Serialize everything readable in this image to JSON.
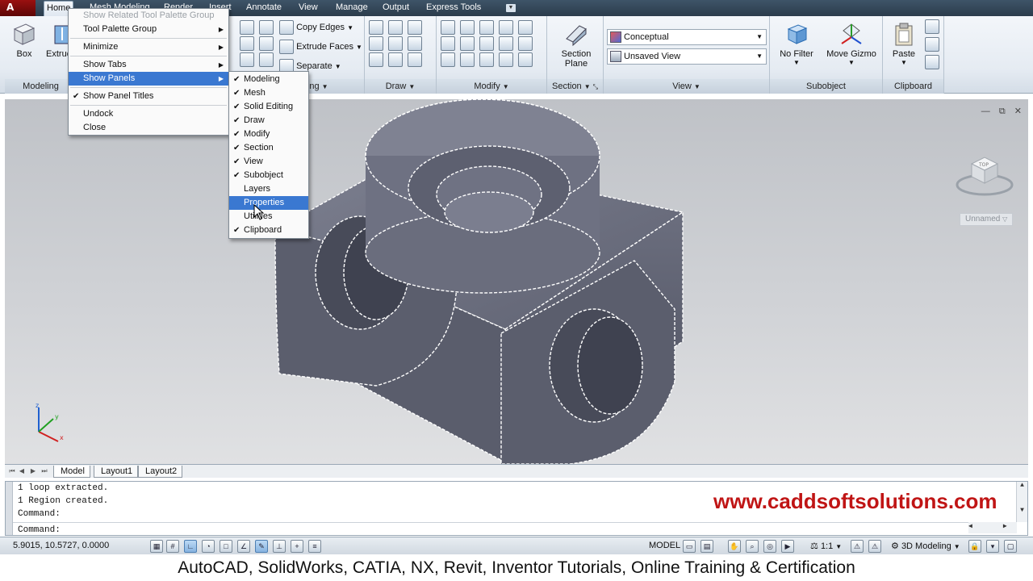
{
  "app": {
    "logo_letter": "A"
  },
  "tabs": [
    {
      "label": "Home",
      "active": true
    },
    {
      "label": "Mesh Modeling"
    },
    {
      "label": "Render"
    },
    {
      "label": "Insert"
    },
    {
      "label": "Annotate"
    },
    {
      "label": "View"
    },
    {
      "label": "Manage"
    },
    {
      "label": "Output"
    },
    {
      "label": "Express Tools"
    }
  ],
  "ribbon": {
    "modeling": {
      "box_label": "Box",
      "extrude_label": "Extrude",
      "title": "Modeling"
    },
    "solid_editing": {
      "copy_edges": "Copy Edges",
      "extrude_faces": "Extrude Faces",
      "separate": "Separate",
      "title": "Solid Editing"
    },
    "draw": {
      "title": "Draw"
    },
    "modify": {
      "title": "Modify"
    },
    "section": {
      "section_plane_line1": "Section",
      "section_plane_line2": "Plane",
      "title": "Section"
    },
    "view": {
      "visual_style": "Conceptual",
      "named_view": "Unsaved View",
      "title": "View"
    },
    "subobject": {
      "no_filter": "No Filter",
      "move_gizmo": "Move Gizmo",
      "title": "Subobject"
    },
    "clipboard": {
      "paste": "Paste",
      "title": "Clipboard"
    }
  },
  "context_menu": {
    "items": [
      {
        "label": "Show Related Tool Palette Group",
        "disabled": true
      },
      {
        "label": "Tool Palette Group",
        "submenu": true
      },
      {
        "sep": true
      },
      {
        "label": "Minimize",
        "submenu": true
      },
      {
        "sep": true
      },
      {
        "label": "Show Tabs",
        "submenu": true
      },
      {
        "label": "Show Panels",
        "submenu": true,
        "highlighted": true
      },
      {
        "sep": true
      },
      {
        "label": "Show Panel Titles",
        "checked": true
      },
      {
        "sep": true
      },
      {
        "label": "Undock"
      },
      {
        "label": "Close"
      }
    ]
  },
  "panels_submenu": {
    "items": [
      {
        "label": "Modeling",
        "checked": true
      },
      {
        "label": "Mesh",
        "checked": true
      },
      {
        "label": "Solid Editing",
        "checked": true
      },
      {
        "label": "Draw",
        "checked": true
      },
      {
        "label": "Modify",
        "checked": true
      },
      {
        "label": "Section",
        "checked": true
      },
      {
        "label": "View",
        "checked": true
      },
      {
        "label": "Subobject",
        "checked": true
      },
      {
        "label": "Layers",
        "checked": false
      },
      {
        "label": "Properties",
        "checked": false,
        "highlighted": true
      },
      {
        "label": "Utilities",
        "checked": false
      },
      {
        "label": "Clipboard",
        "checked": true
      }
    ]
  },
  "viewport": {
    "viewcube_label": "Unnamed",
    "viewcube_face": "TOP",
    "window_controls": [
      "—",
      "⧉",
      "✕"
    ],
    "colors": {
      "background_top": "#bfc2c7",
      "model_fill": "#6c6f80"
    }
  },
  "layout_tabs": [
    "Model",
    "Layout1",
    "Layout2"
  ],
  "command": {
    "history": [
      "1 loop extracted.",
      "1 Region created.",
      "Command:"
    ],
    "prompt": "Command:"
  },
  "watermark": "www.caddsoftsolutions.com",
  "statusbar": {
    "coords": "5.9015, 10.5727, 0.0000",
    "model": "MODEL",
    "scale": "1:1",
    "workspace": "3D Modeling"
  },
  "footer": "AutoCAD, SolidWorks, CATIA, NX, Revit, Inventor Tutorials, Online Training & Certification"
}
